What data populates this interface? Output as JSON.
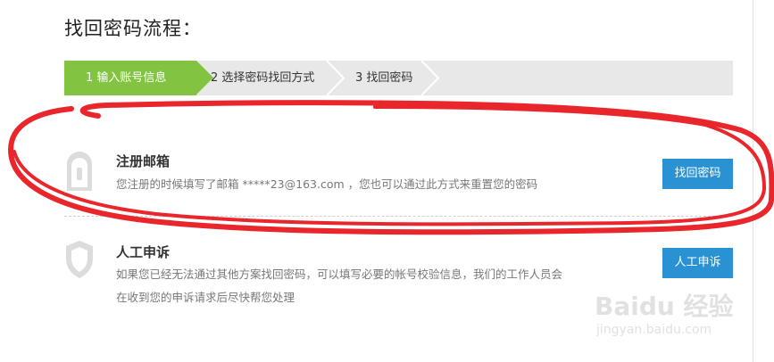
{
  "page": {
    "title": "找回密码流程："
  },
  "steps": [
    {
      "label": "1 输入账号信息",
      "active": true
    },
    {
      "label": "2 选择密码找回方式",
      "active": false
    },
    {
      "label": "3 找回密码",
      "active": false
    }
  ],
  "options": [
    {
      "icon": "mailbox-icon",
      "title": "注册邮箱",
      "desc_lines": [
        "您注册的时候填写了邮箱 *****23@163.com ，您也可以通过此方式来重置您的密码"
      ],
      "button": "找回密码"
    },
    {
      "icon": "shield-icon",
      "title": "人工申诉",
      "desc_lines": [
        "如果您已经无法通过其他方案找回密码，可以填写必要的帐号校验信息，我们的工作人员会",
        "在收到您的申诉请求后尽快帮您处理"
      ],
      "button": "人工申诉"
    }
  ],
  "annotation": {
    "type": "red-hand-drawn-loop",
    "color": "#e8262b"
  },
  "watermark": {
    "brand": "Baidu 经验",
    "url": "jingyan.baidu.com"
  },
  "colors": {
    "step_active": "#82c441",
    "step_bg": "#e8e8e8",
    "button": "#2a92d3"
  }
}
